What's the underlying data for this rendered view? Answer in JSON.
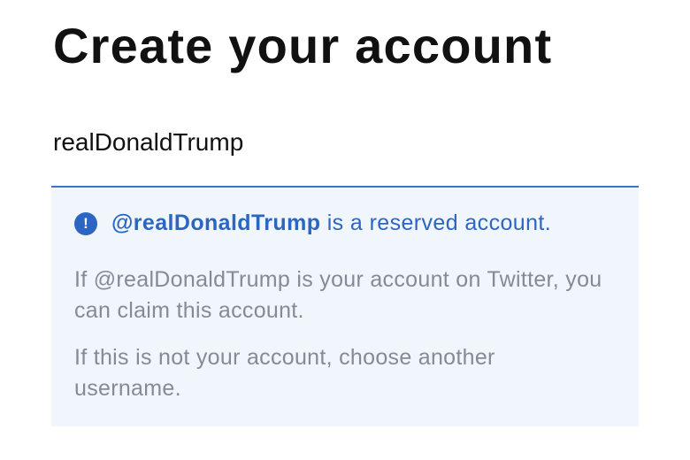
{
  "header": {
    "title": "Create your account"
  },
  "username_field": {
    "value": "realDonaldTrump"
  },
  "notice": {
    "icon": "alert-circle-icon",
    "handle": "@realDonaldTrump",
    "message_suffix": " is a reserved account.",
    "claim_text": "If @realDonaldTrump is your account on Twitter, you can claim this account.",
    "alternative_text": "If this is not your account, choose another username."
  },
  "colors": {
    "accent": "#2b66c2",
    "field_underline": "#3b73c9",
    "notice_background": "#f1f6fc",
    "muted_text": "#858b93"
  }
}
